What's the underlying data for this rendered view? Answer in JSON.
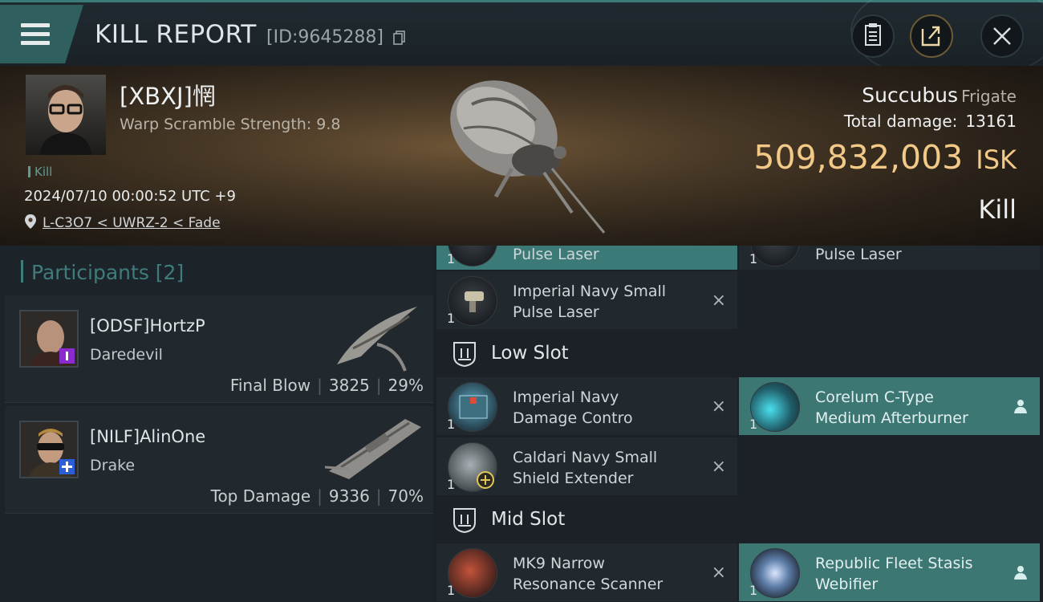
{
  "header": {
    "title": "KILL REPORT",
    "report_id": "[ID:9645288]",
    "icons": [
      "menu-icon",
      "copy-icon",
      "clipboard-icon",
      "share-icon",
      "close-icon"
    ]
  },
  "victim": {
    "pilot_name": "[XBXJ]惘",
    "warp_scramble": "Warp Scramble Strength: 9.8",
    "tag": "Kill",
    "datetime": "2024/07/10 00:00:52 UTC +9",
    "location": "L-C3O7 < UWRZ-2 < Fade",
    "ship_name": "Succubus",
    "ship_class": "Frigate",
    "total_damage_label": "Total damage:",
    "total_damage": "13161",
    "isk_value": "509,832,003",
    "isk_unit": "ISK",
    "result": "Kill"
  },
  "participants": {
    "heading": "Participants [2]",
    "items": [
      {
        "name": "[ODSF]HortzP",
        "ship": "Daredevil",
        "role": "Final Blow",
        "damage": "3825",
        "percent": "29%",
        "badge_color": "#8a2bd0"
      },
      {
        "name": "[NILF]AlinOne",
        "ship": "Drake",
        "role": "Top Damage",
        "damage": "9336",
        "percent": "70%",
        "badge_color": "#2a5fd8"
      }
    ]
  },
  "fitting": {
    "high_partial_left": {
      "qty": "1",
      "name": "Pulse Laser"
    },
    "high_partial_right": {
      "qty": "1",
      "name": "Pulse Laser"
    },
    "high_full": {
      "qty": "1",
      "name": "Imperial Navy Small Pulse Laser",
      "name_l1": "Imperial Navy Small",
      "name_l2": "Pulse Laser",
      "remove": "×"
    },
    "low_slot_label": "Low Slot",
    "low": [
      {
        "qty": "1",
        "name_l1": "Imperial Navy",
        "name_l2": "Damage Contro",
        "remove": "×"
      },
      {
        "qty": "1",
        "name_l1": "Corelum C-Type",
        "name_l2": "Medium Afterburner"
      },
      {
        "qty": "1",
        "name_l1": "Caldari Navy Small",
        "name_l2": "Shield Extender",
        "remove": "×"
      }
    ],
    "mid_slot_label": "Mid Slot",
    "mid": [
      {
        "qty": "1",
        "name_l1": "MK9 Narrow",
        "name_l2": "Resonance Scanner",
        "remove": "×"
      },
      {
        "qty": "1",
        "name_l1": "Republic Fleet Stasis",
        "name_l2": "Webifier"
      }
    ]
  },
  "colors": {
    "accent_teal": "#3b7a77",
    "isk_gold": "#f3c988"
  }
}
